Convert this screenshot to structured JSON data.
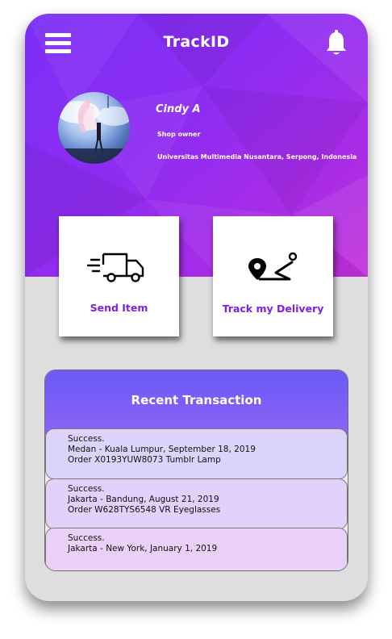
{
  "header": {
    "title": "TrackID",
    "menu_icon": "hamburger-menu-icon",
    "bell_icon": "bell-icon"
  },
  "profile": {
    "name": "Cindy A",
    "role": "Shop owner",
    "location": "Universitas Multimedia Nusantara, Serpong, Indonesia"
  },
  "actions": [
    {
      "label": "Send Item",
      "icon": "delivery-truck-icon"
    },
    {
      "label": "Track my Delivery",
      "icon": "map-route-icon"
    }
  ],
  "transactions": {
    "title": "Recent Transaction",
    "items": [
      {
        "status": "Success.",
        "route": "Medan - Kuala Lumpur, September 18, 2019",
        "order": "Order X0193YUW8073 Tumblr Lamp"
      },
      {
        "status": "Success.",
        "route": "Jakarta - Bandung, August 21, 2019",
        "order": "Order W628TYS6548 VR Eyeglasses"
      },
      {
        "status": "Success.",
        "route": "Jakarta - New York, January 1, 2019"
      }
    ]
  },
  "colors": {
    "hero_gradient_start": "#7b2ff7",
    "hero_gradient_end": "#c22fd8",
    "accent_text": "#7b22e8",
    "panel_header": "#6c59f7"
  }
}
